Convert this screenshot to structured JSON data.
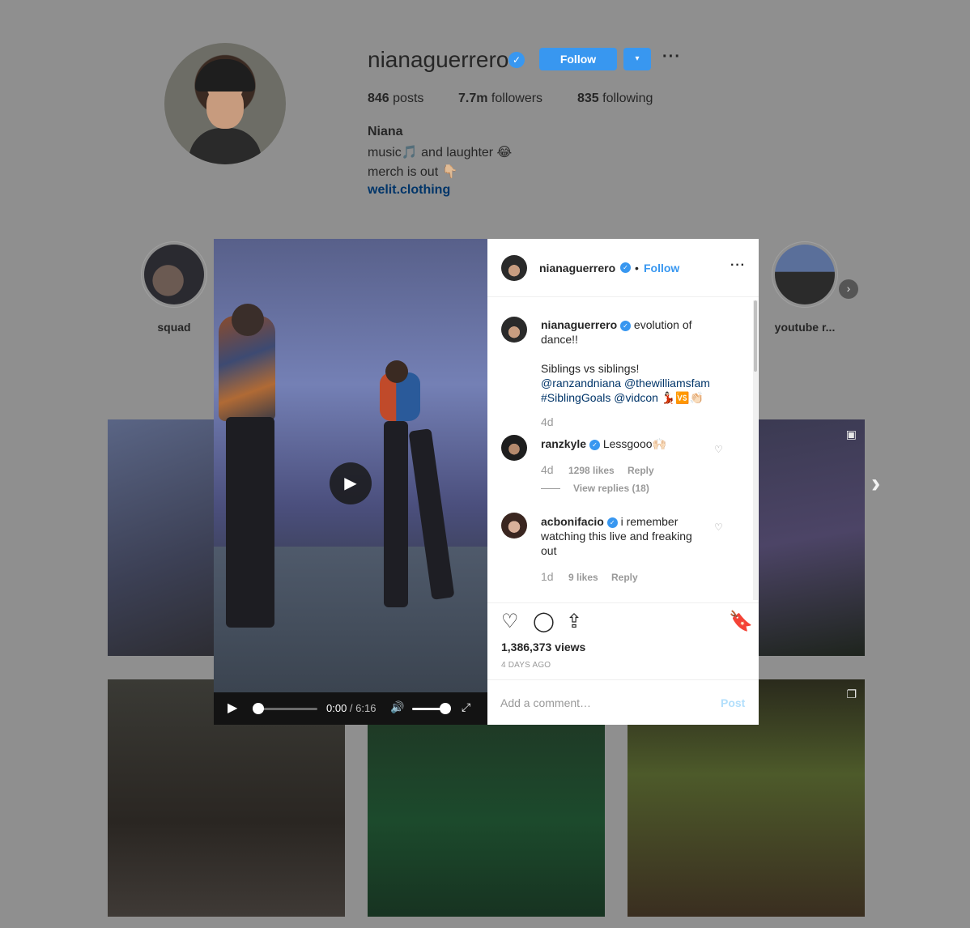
{
  "profile": {
    "username": "nianaguerrero",
    "follow_label": "Follow",
    "dropdown_icon": "▾",
    "more_icon": "···",
    "stats": [
      {
        "count": "846",
        "label": " posts"
      },
      {
        "count": "7.7m",
        "label": " followers"
      },
      {
        "count": "835",
        "label": " following"
      }
    ],
    "bio_name": "Niana",
    "bio_lines": [
      "music🎵 and laughter 😂",
      "merch is out 👇🏼"
    ],
    "bio_link": "welit.clothing"
  },
  "highlights": [
    {
      "label": "squad"
    },
    {
      "label": "youtube r..."
    }
  ],
  "post": {
    "header_username": "nianaguerrero",
    "header_dot": "•",
    "header_follow": "Follow",
    "more_icon": "···",
    "caption_username": "nianaguerrero",
    "caption_text_1": " evolution of dance!!",
    "caption_text_2": "Siblings vs siblings! ",
    "caption_mentions": [
      "@ranzandniana",
      "@thewilliamsfam",
      "#SiblingGoals",
      "@vidcon"
    ],
    "caption_emoji": " 💃🏻🆚👏🏻",
    "caption_time": "4d",
    "comments": [
      {
        "username": "ranzkyle",
        "text": " Lessgooo🙌🏻",
        "time": "4d",
        "likes": "1298 likes",
        "reply": "Reply",
        "view_replies": "View replies (18)"
      },
      {
        "username": "acbonifacio",
        "text": " i remember watching this live and freaking out",
        "time": "1d",
        "likes": "9 likes",
        "reply": "Reply"
      }
    ],
    "views": "1,386,373 views",
    "date": "4 DAYS AGO",
    "comment_placeholder": "Add a comment…",
    "post_label": "Post"
  },
  "video": {
    "current_time": "0:00",
    "separator": " / ",
    "duration": "6:16"
  },
  "colors": {
    "accent": "#3897f0",
    "link": "#003569",
    "muted": "#999999"
  }
}
